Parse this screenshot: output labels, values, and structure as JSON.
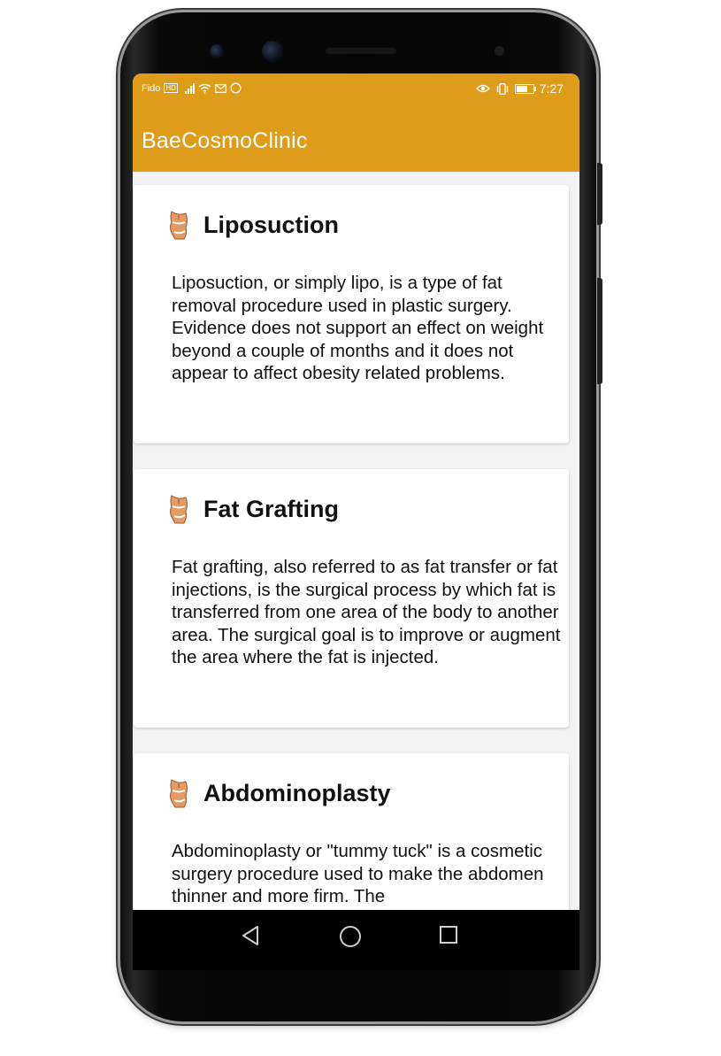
{
  "status_bar": {
    "carrier": "Fido",
    "network_badge": "HD",
    "time": "7:27",
    "icons": [
      "signal-icon",
      "wifi-icon",
      "message-icon",
      "sync-icon",
      "eye-icon",
      "vibrate-icon",
      "battery-icon"
    ]
  },
  "app_bar": {
    "title": "BaeCosmoClinic",
    "color": "#df9c18"
  },
  "procedures": [
    {
      "title": "Liposuction",
      "icon": "body-figure-icon",
      "description": "Liposuction, or simply lipo, is a type of fat removal procedure used in plastic surgery. Evidence does not support an effect on weight beyond a couple of months and it does not appear to affect obesity related problems."
    },
    {
      "title": "Fat Grafting",
      "icon": "body-figure-icon",
      "description": "Fat grafting, also referred to as fat transfer or fat injections, is the surgical process by which fat is transferred from one area of the body to another area. The surgical goal is to improve or augment the area where the fat is injected."
    },
    {
      "title": "Abdominoplasty",
      "icon": "body-figure-icon",
      "description": "Abdominoplasty or \"tummy tuck\" is a cosmetic surgery procedure used to make the abdomen thinner and more firm. The"
    }
  ],
  "nav_bar": {
    "buttons": [
      "back-icon",
      "home-icon",
      "recents-icon"
    ]
  }
}
